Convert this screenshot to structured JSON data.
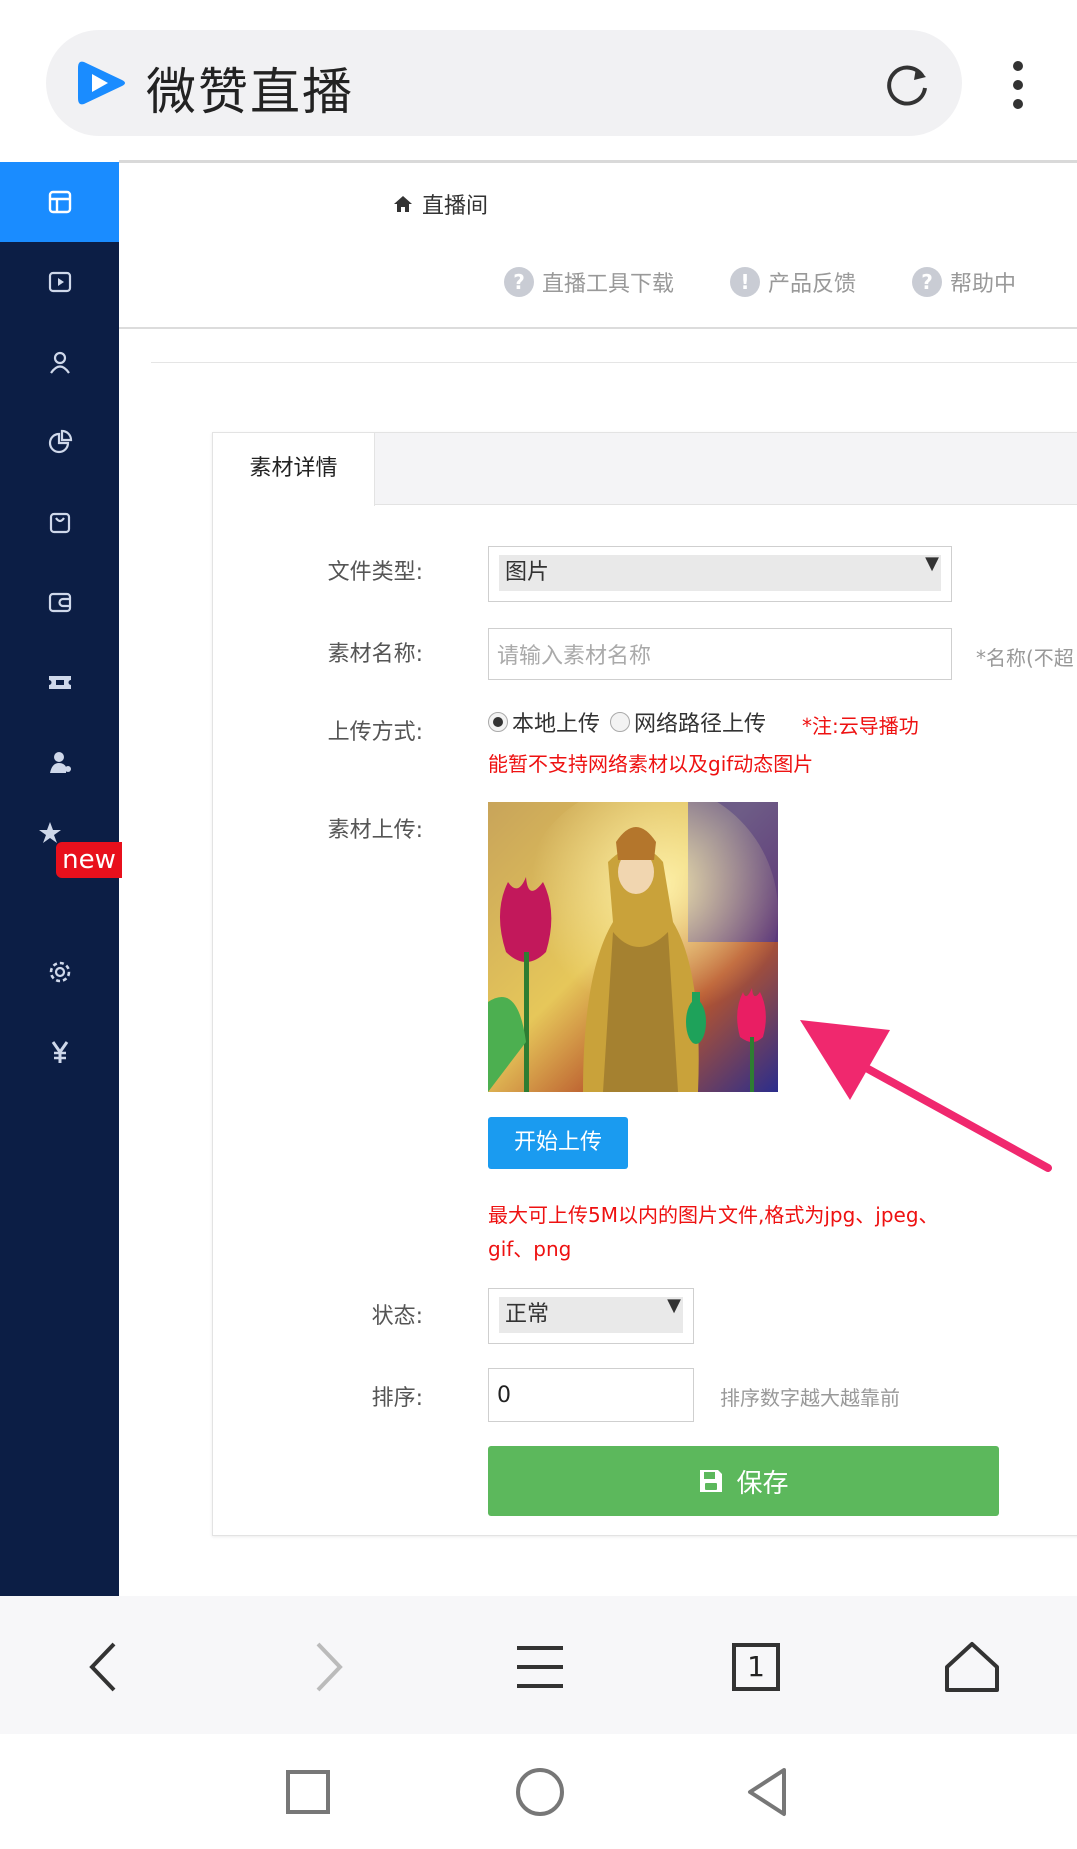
{
  "browser": {
    "app_title": "微赞直播",
    "icons": {
      "logo": "play-logo",
      "reload": "reload-icon",
      "menu": "more-vert-icon"
    }
  },
  "sidebar": {
    "items": [
      {
        "icon": "dashboard-icon",
        "active": true
      },
      {
        "icon": "video-icon"
      },
      {
        "icon": "user-icon"
      },
      {
        "icon": "pie-chart-icon"
      },
      {
        "icon": "bag-icon"
      },
      {
        "icon": "wallet-icon"
      },
      {
        "icon": "ticket-icon"
      },
      {
        "icon": "agent-icon"
      },
      {
        "icon": "star-new-icon",
        "badge": "new"
      },
      {
        "icon": "gear-icon"
      },
      {
        "icon": "yen-icon"
      }
    ]
  },
  "header": {
    "breadcrumb": "直播间",
    "tools": [
      {
        "label": "直播工具下载",
        "icon": "help-icon"
      },
      {
        "label": "产品反馈",
        "icon": "info-icon"
      },
      {
        "label": "帮助中",
        "icon": "help-icon"
      }
    ]
  },
  "panel": {
    "tab": "素材详情",
    "file_type": {
      "label": "文件类型:",
      "value": "图片"
    },
    "name": {
      "label": "素材名称:",
      "placeholder": "请输入素材名称",
      "hint": "*名称(不超"
    },
    "upload_method": {
      "label": "上传方式:",
      "options": [
        "本地上传",
        "网络路径上传"
      ],
      "selected": "本地上传",
      "note_line1": "*注:云导播功",
      "note_line2": "能暂不支持网络素材以及gif动态图片"
    },
    "material_upload": {
      "label": "素材上传:"
    },
    "upload_button": "开始上传",
    "upload_note": "最大可上传5M以内的图片文件,格式为jpg、jpeg、gif、png",
    "status": {
      "label": "状态:",
      "value": "正常"
    },
    "sort": {
      "label": "排序:",
      "value": "0",
      "hint": "排序数字越大越靠前"
    },
    "save_button": "保存"
  },
  "colors": {
    "sidebar_bg": "#0c1e45",
    "sidebar_active": "#1a8cff",
    "upload_btn": "#1a9bf0",
    "save_btn": "#5cb85c",
    "note_red": "#e11111",
    "arrow": "#f0286e"
  },
  "bottom_nav": [
    "back-icon",
    "forward-icon",
    "menu-icon",
    "tabs-icon",
    "home-icon"
  ],
  "tabs_count": "1",
  "system_nav": [
    "recent-apps-icon",
    "home-circle-icon",
    "back-triangle-icon"
  ]
}
